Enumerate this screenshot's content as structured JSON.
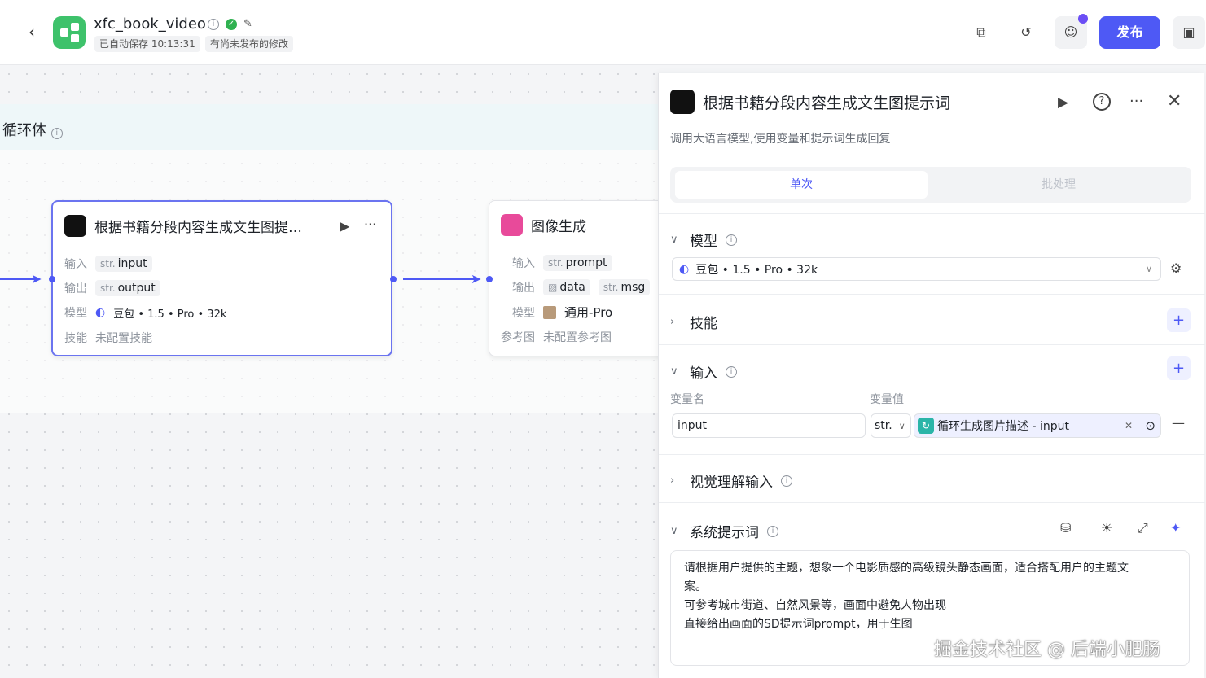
{
  "header": {
    "title": "xfc_book_video",
    "autosave": "已自动保存 10:13:31",
    "unpublished": "有尚未发布的修改",
    "publish_label": "发布"
  },
  "canvas": {
    "loop_title": "循环体",
    "node1": {
      "title": "根据书籍分段内容生成文生图提…",
      "input_label": "输入",
      "input_type": "str.",
      "input_name": "input",
      "output_label": "输出",
      "output_type": "str.",
      "output_name": "output",
      "model_label": "模型",
      "model_value": "豆包 • 1.5 • Pro • 32k",
      "skill_label": "技能",
      "skill_value": "未配置技能"
    },
    "node2": {
      "title": "图像生成",
      "input_label": "输入",
      "input_type": "str.",
      "input_name": "prompt",
      "output_label": "输出",
      "output_name1": "data",
      "output_type2": "str.",
      "output_name2": "msg",
      "model_label": "模型",
      "model_value": "通用-Pro",
      "ref_label": "参考图",
      "ref_value": "未配置参考图"
    }
  },
  "panel": {
    "title": "根据书籍分段内容生成文生图提示词",
    "description": "调用大语言模型,使用变量和提示词生成回复",
    "tab_single": "单次",
    "tab_batch": "批处理",
    "model_section": "模型",
    "model_value": "豆包 • 1.5 • Pro • 32k",
    "skill_section": "技能",
    "input_section": "输入",
    "col_name": "变量名",
    "col_value": "变量值",
    "var_name": "input",
    "var_type": "str.",
    "var_ref": "循环生成图片描述 - input",
    "vision_section": "视觉理解输入",
    "system_section": "系统提示词",
    "system_prompt_lines": [
      "请根据用户提供的主题，想象一个电影质感的高级镜头静态画面，适合搭配用户的主题文",
      "案。",
      "可参考城市街道、自然风景等，画面中避免人物出现",
      "直接给出画面的SD提示词prompt，用于生图"
    ]
  },
  "watermark": "掘金技术社区 @ 后端小肥肠",
  "colors": {
    "accent": "#4e59f5",
    "logo": "#3ec26b",
    "image_node": "#e84a9a"
  }
}
